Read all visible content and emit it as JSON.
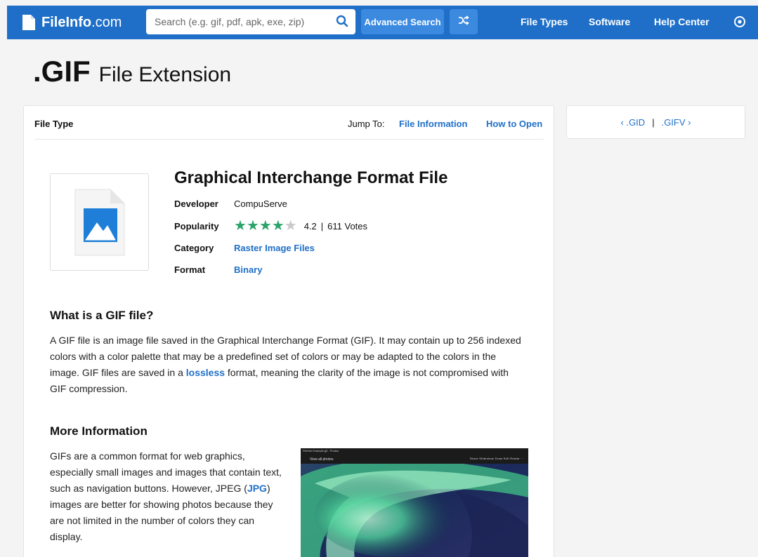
{
  "header": {
    "logo_main": "FileInfo",
    "logo_suffix": ".com",
    "search_placeholder": "Search (e.g. gif, pdf, apk, exe, zip)",
    "advanced_search": "Advanced Search",
    "nav": [
      "File Types",
      "Software",
      "Help Center"
    ],
    "icons": [
      "file-icon",
      "search-icon",
      "shuffle-icon",
      "settings-icon"
    ],
    "color": "#1f6fc8"
  },
  "title": {
    "ext": ".GIF",
    "rest": "File Extension"
  },
  "card": {
    "file_type_label": "File Type",
    "jump_to": "Jump To:",
    "jump_links": [
      "File Information",
      "How to Open"
    ],
    "file_name": "Graphical Interchange Format File",
    "developer_label": "Developer",
    "developer": "CompuServe",
    "popularity_label": "Popularity",
    "rating": 4.2,
    "rating_text": "4.2",
    "separator": "|",
    "votes": "611 Votes",
    "category_label": "Category",
    "category": "Raster Image Files",
    "format_label": "Format",
    "format": "Binary"
  },
  "what_is": {
    "heading": "What is a GIF file?",
    "text_before": "A GIF file is an image file saved in the Graphical Interchange Format (GIF). It may contain up to 256 indexed colors with a color palette that may be a predefined set of colors or may be adapted to the colors in the image. GIF files are saved in a ",
    "link": "lossless",
    "text_after": " format, meaning the clarity of the image is not compromised with GIF compression."
  },
  "more_info": {
    "heading": "More Information",
    "text_before": "GIFs are a common format for web graphics, especially small images and images that contain text, such as navigation buttons. However, JPEG (",
    "link": "JPG",
    "text_after": ") images are better for showing photos because they are not limited in the number of colors they can display."
  },
  "screenshot": {
    "window_title": "FileInfo Example.gif - Photos",
    "view_all": "View all photos",
    "tools": "Share   Slideshow   Draw   Edit   Rotate   ···"
  },
  "side": {
    "prev": "‹ .GID",
    "sep": "|",
    "next": ".GIFV ›"
  }
}
